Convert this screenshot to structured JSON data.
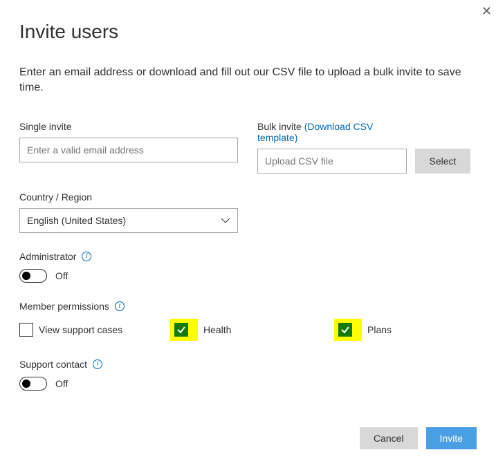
{
  "close_label": "✕",
  "title": "Invite users",
  "description": "Enter an email address or download and fill out our CSV file to upload a bulk invite to save time.",
  "single_invite": {
    "label": "Single invite",
    "placeholder": "Enter a valid email address"
  },
  "bulk_invite": {
    "label": "Bulk invite",
    "link_text": "(Download CSV template)",
    "placeholder": "Upload CSV file",
    "select_label": "Select"
  },
  "country": {
    "label": "Country / Region",
    "value": "English (United States)"
  },
  "administrator": {
    "label": "Administrator",
    "state": "Off"
  },
  "member_permissions": {
    "label": "Member permissions",
    "items": [
      {
        "label": "View support cases",
        "checked": false,
        "highlighted": false
      },
      {
        "label": "Health",
        "checked": true,
        "highlighted": true
      },
      {
        "label": "Plans",
        "checked": true,
        "highlighted": true
      }
    ]
  },
  "support_contact": {
    "label": "Support contact",
    "state": "Off"
  },
  "footer": {
    "cancel": "Cancel",
    "invite": "Invite"
  }
}
